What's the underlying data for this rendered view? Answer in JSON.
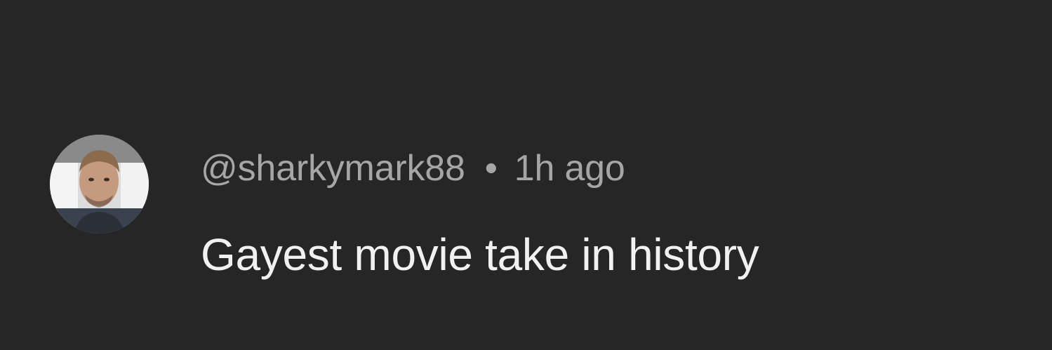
{
  "comment": {
    "username": "@sharkymark88",
    "separator": "•",
    "timestamp": "1h ago",
    "text": "Gayest movie take in history"
  },
  "avatar": {
    "icon": "user-avatar-photo"
  },
  "colors": {
    "background": "#262626",
    "meta_text": "#a6a6a6",
    "comment_text": "#f1f1f1"
  }
}
